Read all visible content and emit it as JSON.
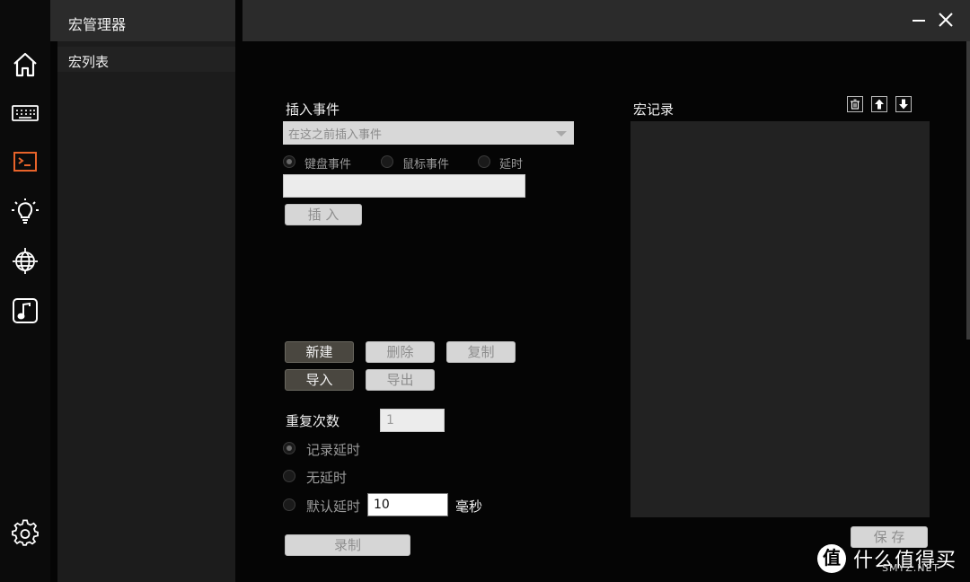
{
  "sidebar": {
    "icons": [
      {
        "name": "home-icon"
      },
      {
        "name": "keyboard-icon"
      },
      {
        "name": "macro-terminal-icon",
        "active": true
      },
      {
        "name": "lightbulb-icon"
      },
      {
        "name": "globe-icon"
      },
      {
        "name": "music-note-icon"
      }
    ],
    "settings_icon": "gear-icon"
  },
  "list": {
    "title": "宏管理器",
    "section": "宏列表"
  },
  "insert_event": {
    "label": "插入事件",
    "position_select": "在这之前插入事件",
    "event_types": [
      "键盘事件",
      "鼠标事件",
      "延时"
    ],
    "selected_event_type": "键盘事件",
    "value": "",
    "insert_button": "插 入"
  },
  "actions": {
    "new": "新建",
    "delete": "删除",
    "copy": "复制",
    "import": "导入",
    "export": "导出"
  },
  "repeat": {
    "label": "重复次数",
    "value": "1"
  },
  "delay_options": {
    "record_delay": "记录延时",
    "no_delay": "无延时",
    "default_delay": "默认延时",
    "selected": "记录延时",
    "default_delay_value": "10",
    "unit": "毫秒"
  },
  "record_button": "录制",
  "macro_record": {
    "title": "宏记录",
    "save_button": "保 存",
    "tools": [
      "trash-icon",
      "arrow-up-icon",
      "arrow-down-icon"
    ]
  },
  "watermark": {
    "badge": "值",
    "text": "什么值得买",
    "sub": "SMYZ.NET"
  },
  "colors": {
    "accent": "#e8632a",
    "background": "#050505",
    "panel": "#222222"
  }
}
